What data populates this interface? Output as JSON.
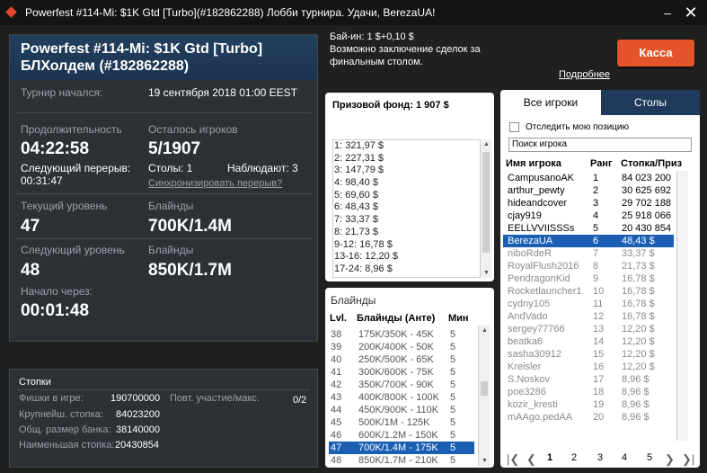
{
  "window": {
    "title": "Powerfest #114-Mi: $1K Gtd [Turbo](#182862288) Лобби турнира. Удачи, BerezaUA!",
    "min": "–",
    "close": "✕"
  },
  "tournament": {
    "name_line1": "Powerfest #114-Mi: $1K Gtd [Turbo]",
    "name_line2": "БЛХолдем (#182862288)",
    "started_label": "Турнир начался:",
    "started_value": "19 сентября 2018  01:00 EEST",
    "duration_label": "Продолжительность",
    "duration_value": "04:22:58",
    "next_break_label": "Следующий перерыв:",
    "next_break_value": "00:31:47",
    "remaining_label": "Осталось игроков",
    "remaining_value": "5/1907",
    "tables_text": "Столы: 1",
    "observers_text": "Наблюдают: 3",
    "sync_link": "Синхронизировать перерыв?",
    "cur_level_label": "Текущий уровень",
    "cur_level_value": "47",
    "cur_blinds_label": "Блайнды",
    "cur_blinds_value": "700K/1.4M",
    "next_level_label": "Следующий уровень",
    "next_level_value": "48",
    "next_blinds_label": "Блайнды",
    "next_blinds_value": "850K/1.7M",
    "start_in_label": "Начало через:",
    "start_in_value": "00:01:48"
  },
  "stats": {
    "title": "Стопки",
    "chips_label": "Фишки в игре:",
    "chips_value": "190700000",
    "largest_label": "Крупнейш. стопка:",
    "largest_value": "84023200",
    "avg_label": "Общ. размер банка:",
    "avg_value": "38140000",
    "smallest_label": "Наименьшая стопка:",
    "smallest_value": "20430854",
    "rebuy_label": "Повт. участие/макс.",
    "rebuy_value": "0/2"
  },
  "buyin": {
    "line1": "Бай-ин: 1 $+0,10 $",
    "line2": "Возможно заключение сделок за",
    "line3": "финальным столом.",
    "more": "Подробнее",
    "cashier": "Касса"
  },
  "prize": {
    "title": "Призовой фонд: 1 907 $",
    "rows": [
      "1: 321,97 $",
      "2: 227,31 $",
      "3: 147,79 $",
      "4: 98,40 $",
      "5: 69,60 $",
      "6: 48,43 $",
      "7: 33,37 $",
      "8: 21,73 $",
      "9-12: 16,78 $",
      "13-16: 12,20 $",
      "17-24: 8,96 $"
    ]
  },
  "blinds": {
    "title": "Блайнды",
    "col_lvl": "Lvl.",
    "col_blinds": "Блайнды (Анте)",
    "col_min": "Мин",
    "rows": [
      [
        "38",
        "175K/350K - 45K",
        "5"
      ],
      [
        "39",
        "200K/400K - 50K",
        "5"
      ],
      [
        "40",
        "250K/500K - 65K",
        "5"
      ],
      [
        "41",
        "300K/600K - 75K",
        "5"
      ],
      [
        "42",
        "350K/700K - 90K",
        "5"
      ],
      [
        "43",
        "400K/800K - 100K",
        "5"
      ],
      [
        "44",
        "450K/900K - 110K",
        "5"
      ],
      [
        "45",
        "500K/1M - 125K",
        "5"
      ],
      [
        "46",
        "600K/1.2M - 150K",
        "5"
      ],
      [
        "47",
        "700K/1.4M - 175K",
        "5"
      ],
      [
        "48",
        "850K/1.7M - 210K",
        "5"
      ]
    ],
    "selected": 9
  },
  "players": {
    "tab_all": "Все игроки",
    "tab_tables": "Столы",
    "track_label": "Отследить мою позицию",
    "search_placeholder": "Поиск игрока",
    "col_name": "Имя игрока",
    "col_rank": "Ранг",
    "col_stack": "Стопка/Приз",
    "rows": [
      [
        "CampusanoAK",
        "1",
        "84 023 200"
      ],
      [
        "arthur_pewty",
        "2",
        "30 625 692"
      ],
      [
        "hideandcover",
        "3",
        "29 702 188"
      ],
      [
        "cjay919",
        "4",
        "25 918 066"
      ],
      [
        "EELLVVIISSSs",
        "5",
        "20 430 854"
      ],
      [
        "BerezaUA",
        "6",
        "48,43 $"
      ],
      [
        "niboRdeR",
        "7",
        "33,37 $"
      ],
      [
        "RoyalFlush2016",
        "8",
        "21,73 $"
      ],
      [
        "PendragonKid",
        "9",
        "16,78 $"
      ],
      [
        "Rocketlauncher1",
        "10",
        "16,78 $"
      ],
      [
        "cydny105",
        "11",
        "16,78 $"
      ],
      [
        "AndVado",
        "12",
        "16,78 $"
      ],
      [
        "sergey77766",
        "13",
        "12,20 $"
      ],
      [
        "beatka6",
        "14",
        "12,20 $"
      ],
      [
        "sasha30912",
        "15",
        "12,20 $"
      ],
      [
        "Kreisler",
        "16",
        "12,20 $"
      ],
      [
        "S.Noskov",
        "17",
        "8,96 $"
      ],
      [
        "poe3286",
        "18",
        "8,96 $"
      ],
      [
        "kozir_kresti",
        "19",
        "8,96 $"
      ],
      [
        "mAAgo.pedAA",
        "20",
        "8,96 $"
      ]
    ],
    "selected": 5,
    "pages": [
      "1",
      "2",
      "3",
      "4",
      "5"
    ],
    "first": "|❮",
    "prev": "❮",
    "next": "❯",
    "last": "❯|"
  },
  "colors": {
    "accent": "#e4542c",
    "select": "#1a5fb4",
    "tab_dark": "#1f3a5a"
  }
}
